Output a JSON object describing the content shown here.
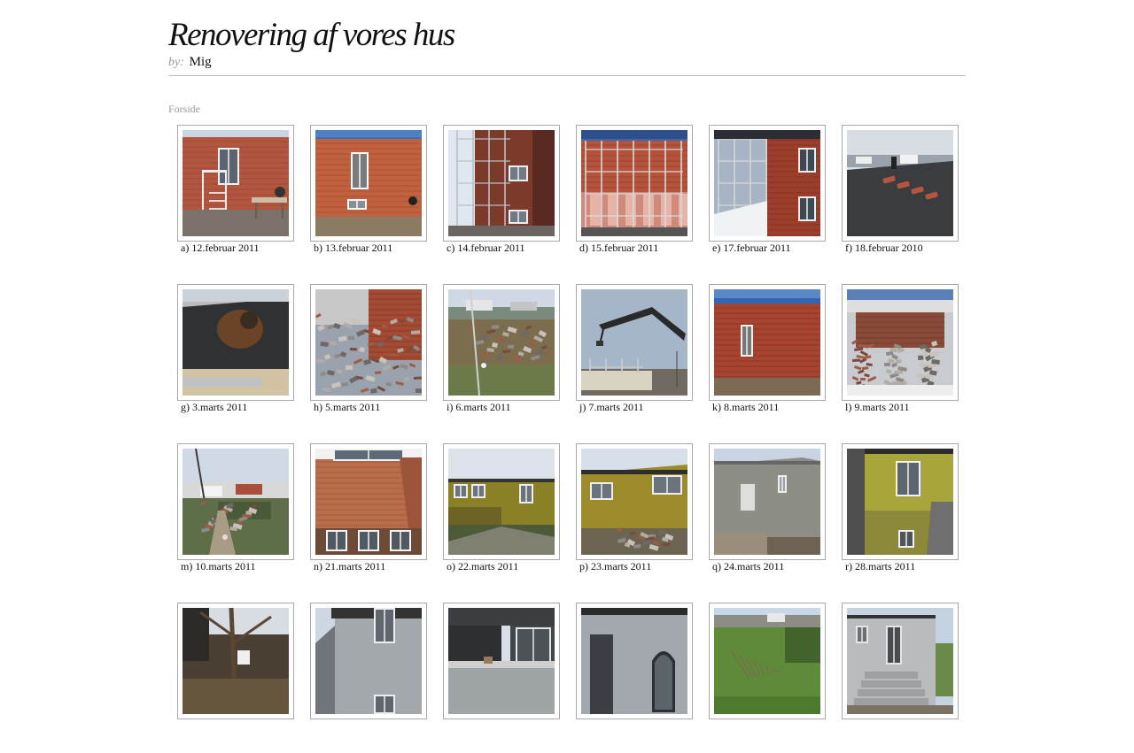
{
  "site": {
    "title": "Renovering af vores hus",
    "by_label": "by:",
    "author": "Mig"
  },
  "breadcrumb": "Forside",
  "gallery": {
    "items": [
      {
        "caption": "a) 12.februar 2011",
        "scene": "brick-stairs"
      },
      {
        "caption": "b) 13.februar 2011",
        "scene": "brick-door"
      },
      {
        "caption": "c) 14.februar 2011",
        "scene": "scaffold-side"
      },
      {
        "caption": "d) 15.februar 2011",
        "scene": "brick-insulation"
      },
      {
        "caption": "e) 17.februar 2011",
        "scene": "scaffold-snow"
      },
      {
        "caption": "f) 18.februar 2010",
        "scene": "roof-tiles"
      },
      {
        "caption": "g) 3.marts 2011",
        "scene": "worker-roof"
      },
      {
        "caption": "h) 5.marts 2011",
        "scene": "brick-rubble"
      },
      {
        "caption": "i) 6.marts 2011",
        "scene": "garden-view"
      },
      {
        "caption": "j) 7.marts 2011",
        "scene": "crane-sky"
      },
      {
        "caption": "k) 8.marts 2011",
        "scene": "brick-wall-sky"
      },
      {
        "caption": "l) 9.marts 2011",
        "scene": "rubble-pit"
      },
      {
        "caption": "m) 10.marts 2011",
        "scene": "street-rubble"
      },
      {
        "caption": "n) 21.marts 2011",
        "scene": "brick-window"
      },
      {
        "caption": "o) 22.marts 2011",
        "scene": "yellow-house"
      },
      {
        "caption": "p) 23.marts 2011",
        "scene": "yellow-house-2"
      },
      {
        "caption": "q) 24.marts 2011",
        "scene": "grey-house"
      },
      {
        "caption": "r) 28.marts 2011",
        "scene": "yellow-side"
      },
      {
        "caption": "",
        "scene": "tree-garden"
      },
      {
        "caption": "",
        "scene": "grey-corner"
      },
      {
        "caption": "",
        "scene": "grey-balcony"
      },
      {
        "caption": "",
        "scene": "grey-arched-window"
      },
      {
        "caption": "",
        "scene": "garden-branches"
      },
      {
        "caption": "",
        "scene": "grey-stairs"
      }
    ]
  }
}
